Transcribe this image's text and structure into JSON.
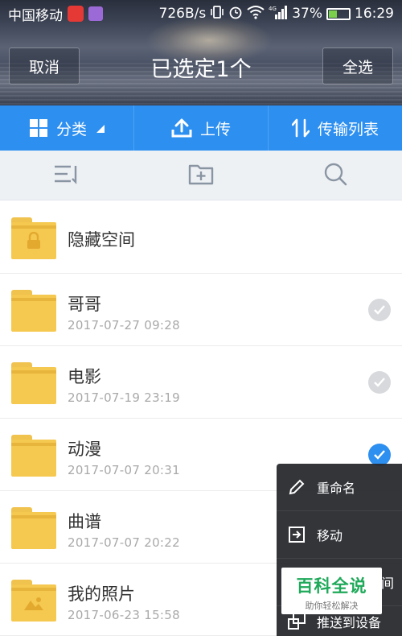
{
  "status_bar": {
    "carrier": "中国移动",
    "net_speed": "726B/s",
    "network": "4G",
    "battery_percent": "37%",
    "battery_level": 0.37,
    "time": "16:29"
  },
  "header": {
    "cancel_label": "取消",
    "title": "已选定1个",
    "select_all_label": "全选"
  },
  "action_bar": {
    "classify_label": "分类",
    "upload_label": "上传",
    "transfer_label": "传输列表"
  },
  "colors": {
    "accent": "#2d8ff0",
    "folder": "#f5c84f",
    "menu_bg": "#2a2c30",
    "watermark_green": "#1fa95a"
  },
  "files": [
    {
      "name": "隐藏空间",
      "date": "",
      "icon": "lock-icon",
      "selected": null
    },
    {
      "name": "哥哥",
      "date": "2017-07-27  09:28",
      "icon": "folder-icon",
      "selected": false
    },
    {
      "name": "电影",
      "date": "2017-07-19  23:19",
      "icon": "folder-icon",
      "selected": false
    },
    {
      "name": "动漫",
      "date": "2017-07-07  20:31",
      "icon": "folder-icon",
      "selected": true
    },
    {
      "name": "曲谱",
      "date": "2017-07-07  20:22",
      "icon": "folder-icon",
      "selected": false
    },
    {
      "name": "我的照片",
      "date": "2017-06-23  15:58",
      "icon": "image-folder-icon",
      "selected": false
    }
  ],
  "popup_menu": {
    "rename_label": "重命名",
    "move_label": "移动",
    "partial_label": "间",
    "push_label": "推送到设备"
  },
  "watermark": {
    "main": "百科全说",
    "sub": "助你轻松解决"
  }
}
